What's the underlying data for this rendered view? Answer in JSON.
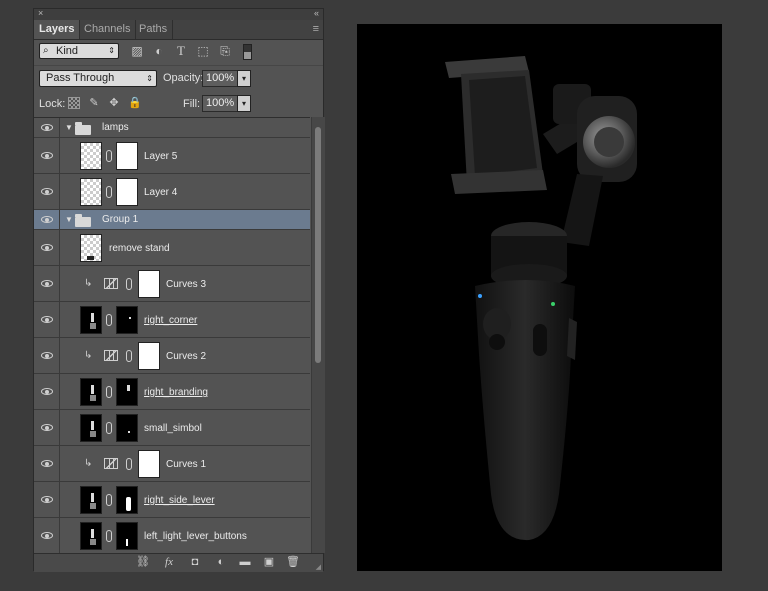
{
  "panel": {
    "close_glyph": "×",
    "collapse_glyph": "«",
    "tabs": [
      {
        "label": "Layers",
        "active": true
      },
      {
        "label": "Channels",
        "active": false
      },
      {
        "label": "Paths",
        "active": false
      }
    ],
    "menu_glyph": "≡",
    "filter": {
      "value": "Kind",
      "search_icon": "⌕",
      "arrow": "⇕"
    },
    "filter_icons": [
      "image-filter-icon",
      "adjustment-filter-icon",
      "type-filter-icon",
      "shape-filter-icon",
      "smart-object-filter-icon"
    ],
    "blend_mode": "Pass Through",
    "opacity_label": "Opacity:",
    "opacity_value": "100%",
    "lock_label": "Lock:",
    "fill_label": "Fill:",
    "fill_value": "100%"
  },
  "layers": [
    {
      "name": "lamps",
      "kind": "group",
      "expanded": true
    },
    {
      "name": "Layer 5",
      "kind": "pixel-mask"
    },
    {
      "name": "Layer 4",
      "kind": "pixel-mask"
    },
    {
      "name": "Group 1",
      "kind": "group",
      "expanded": true,
      "selected": true
    },
    {
      "name": "remove stand",
      "kind": "pixel"
    },
    {
      "name": "Curves 3",
      "kind": "adjustment",
      "clipped": true
    },
    {
      "name": "right_corner",
      "kind": "smart-mask",
      "linked_style": true
    },
    {
      "name": "Curves 2",
      "kind": "adjustment",
      "clipped": true
    },
    {
      "name": "right_branding",
      "kind": "smart-mask",
      "linked_style": true
    },
    {
      "name": "small_simbol",
      "kind": "smart-mask"
    },
    {
      "name": "Curves 1",
      "kind": "adjustment",
      "clipped": true
    },
    {
      "name": "right_side_lever",
      "kind": "smart-mask",
      "linked_style": true
    },
    {
      "name": "left_light_lever_buttons",
      "kind": "smart-mask"
    }
  ],
  "bottom_icons": [
    {
      "name": "link-layers-icon",
      "glyph": "⛓"
    },
    {
      "name": "fx-icon",
      "glyph": "fx"
    },
    {
      "name": "add-mask-icon",
      "glyph": "◘"
    },
    {
      "name": "adjustment-layer-icon",
      "glyph": "◐"
    },
    {
      "name": "new-group-icon",
      "glyph": "▬"
    },
    {
      "name": "new-layer-icon",
      "glyph": "▣"
    },
    {
      "name": "delete-layer-icon",
      "glyph": "🗑"
    }
  ],
  "colors": {
    "panel_bg": "#535353",
    "selected_row": "#6b7b8f",
    "canvas_bg": "#000000",
    "status_blue": "#3aa0ff",
    "status_green": "#3ad06a"
  }
}
